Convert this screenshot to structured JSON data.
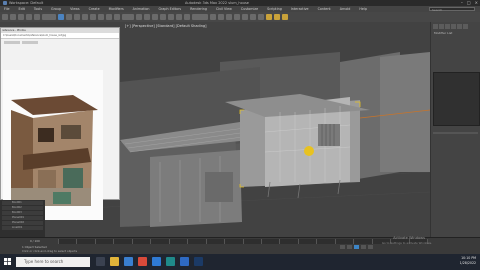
{
  "window": {
    "title": "Autodesk 3ds Max 2022    slum_house",
    "app_tab": "Workspace: Default"
  },
  "menubar": {
    "items": [
      "File",
      "Edit",
      "Tools",
      "Group",
      "Views",
      "Create",
      "Modifiers",
      "Animation",
      "Graph Editors",
      "Rendering",
      "Civil View",
      "Customize",
      "Scripting",
      "Interactive",
      "Content",
      "Arnold",
      "Help"
    ],
    "search_placeholder": "Search"
  },
  "viewport": {
    "label": "[+] [Perspective] [Standard] [Default Shading]"
  },
  "reference_window": {
    "header": "reference - Photos",
    "address": "C:\\Users\\Documents\\reference\\slum_house_ref.jpg",
    "toolbar": [
      "Edit & Create",
      "Share"
    ]
  },
  "command_panel": {
    "modifier_label": "Modifier List"
  },
  "layers": {
    "items": [
      "Box001",
      "Box002",
      "Box003",
      "Plane001",
      "Plane002",
      "Line001"
    ]
  },
  "timeline": {
    "frame": "0 / 100"
  },
  "status": {
    "line1": "1 Object Selected",
    "line2": "Click or click-and-drag to select objects",
    "activate_title": "Activate Windows",
    "activate_sub": "Go to Settings to activate Windows."
  },
  "taskbar": {
    "search_placeholder": "Type here to search",
    "time": "10:10 PM",
    "date": "1/28/2022"
  },
  "colors": {
    "selection_yellow": "#e8c220",
    "accent_blue": "#3d85c6"
  }
}
